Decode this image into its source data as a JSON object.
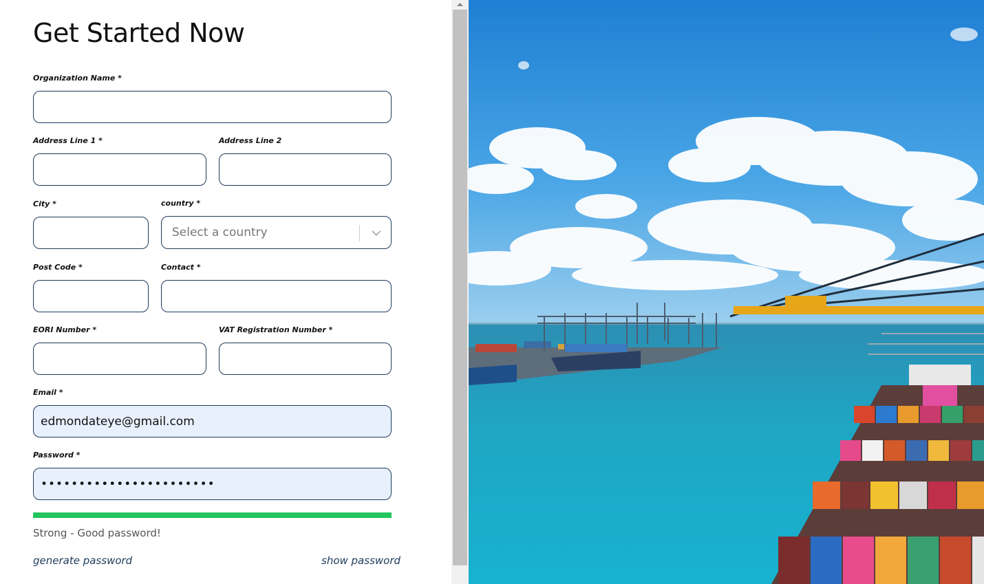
{
  "form": {
    "title": "Get Started Now",
    "org_label": "Organization Name *",
    "addr1_label": "Address Line 1 *",
    "addr2_label": "Address Line 2",
    "city_label": "City *",
    "country_label": "country *",
    "country_placeholder": "Select a country",
    "postcode_label": "Post Code *",
    "contact_label": "Contact *",
    "eori_label": "EORI Number *",
    "vat_label": "VAT Registration Number *",
    "email_label": "Email *",
    "email_value": "edmondateye@gmail.com",
    "password_label": "Password *",
    "password_value": "•••••••••••••••••••••••",
    "strength_text": "Strong - Good password!",
    "generate_link": "generate password",
    "show_link": "show password"
  },
  "colors": {
    "input_border": "#1d3b5a",
    "filled_bg": "#e8f0fe",
    "strength_bar": "#22c55e"
  },
  "icons": {
    "country_chevron": "chevron-down-icon",
    "scroll_up": "arrow-up-icon"
  }
}
